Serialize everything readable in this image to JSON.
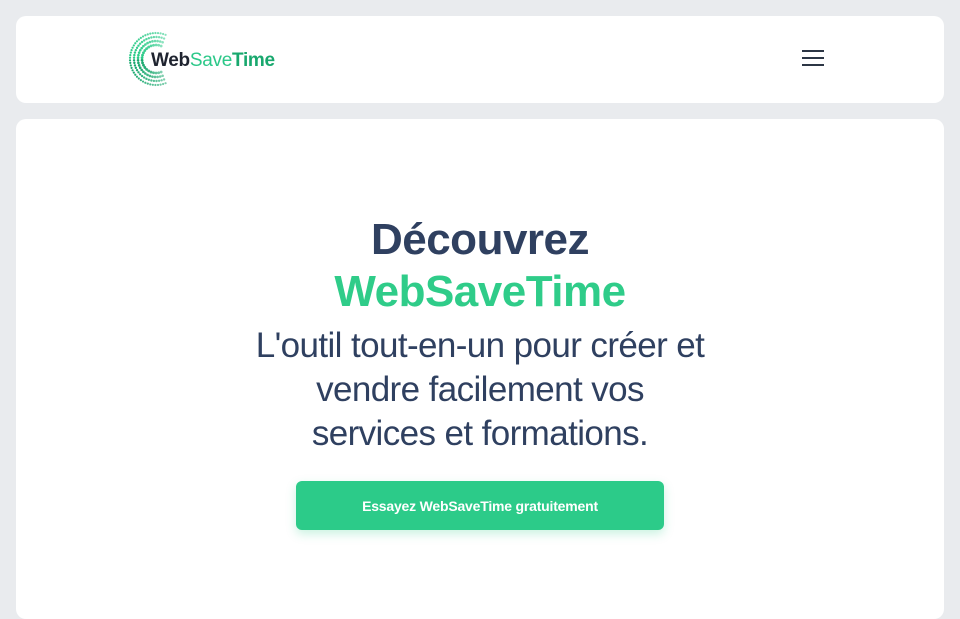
{
  "header": {
    "logo": {
      "part1": "Web",
      "part2": "Save",
      "part3": "Time"
    },
    "menu_icon": "hamburger-menu-icon"
  },
  "hero": {
    "title_line1": "Découvrez",
    "title_line2": "WebSaveTime",
    "subtitle": "L'outil tout-en-un pour créer et vendre facilement vos services et formations.",
    "cta_label": "Essayez WebSaveTime gratuitement"
  },
  "colors": {
    "accent": "#2ccb89",
    "title_dark": "#2f4060",
    "background": "#e9ebee",
    "card": "#ffffff"
  }
}
